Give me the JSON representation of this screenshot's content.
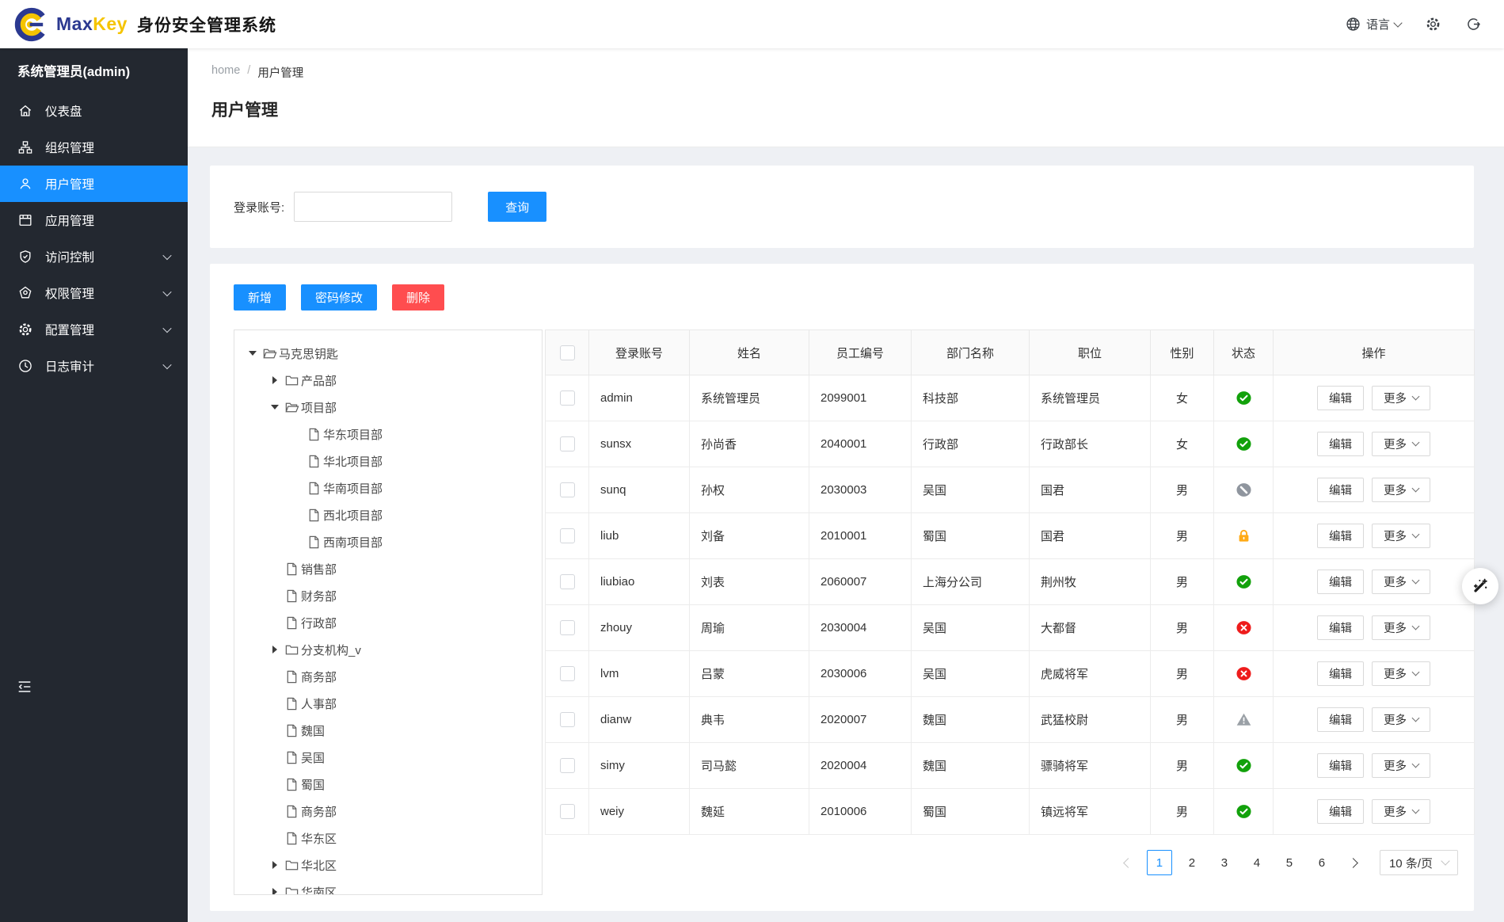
{
  "header": {
    "brand_max": "Max",
    "brand_key": "Key",
    "app_title": "身份安全管理系统",
    "language_label": "语言"
  },
  "sidebar": {
    "user_title": "系统管理员(admin)",
    "items": [
      {
        "key": "dashboard",
        "label": "仪表盘",
        "active": false,
        "expandable": false
      },
      {
        "key": "org",
        "label": "组织管理",
        "active": false,
        "expandable": false
      },
      {
        "key": "user",
        "label": "用户管理",
        "active": true,
        "expandable": false
      },
      {
        "key": "app",
        "label": "应用管理",
        "active": false,
        "expandable": false
      },
      {
        "key": "access",
        "label": "访问控制",
        "active": false,
        "expandable": true
      },
      {
        "key": "permission",
        "label": "权限管理",
        "active": false,
        "expandable": true
      },
      {
        "key": "config",
        "label": "配置管理",
        "active": false,
        "expandable": true
      },
      {
        "key": "audit",
        "label": "日志审计",
        "active": false,
        "expandable": true
      }
    ]
  },
  "breadcrumb": {
    "home": "home",
    "separator": "/",
    "current": "用户管理"
  },
  "page": {
    "title": "用户管理"
  },
  "search": {
    "label": "登录账号:",
    "input_value": "",
    "query_button": "查询"
  },
  "toolbar": {
    "add": "新增",
    "change_password": "密码修改",
    "delete": "删除"
  },
  "tree": {
    "nodes": [
      {
        "label": "马克思钥匙",
        "level": 0,
        "caret": "open",
        "icon": "folder-open"
      },
      {
        "label": "产品部",
        "level": 1,
        "caret": "closed",
        "icon": "folder-closed"
      },
      {
        "label": "项目部",
        "level": 1,
        "caret": "open",
        "icon": "folder-open"
      },
      {
        "label": "华东项目部",
        "level": 2,
        "caret": null,
        "icon": "file"
      },
      {
        "label": "华北项目部",
        "level": 2,
        "caret": null,
        "icon": "file"
      },
      {
        "label": "华南项目部",
        "level": 2,
        "caret": null,
        "icon": "file"
      },
      {
        "label": "西北项目部",
        "level": 2,
        "caret": null,
        "icon": "file"
      },
      {
        "label": "西南项目部",
        "level": 2,
        "caret": null,
        "icon": "file"
      },
      {
        "label": "销售部",
        "level": 1,
        "caret": null,
        "icon": "file"
      },
      {
        "label": "财务部",
        "level": 1,
        "caret": null,
        "icon": "file"
      },
      {
        "label": "行政部",
        "level": 1,
        "caret": null,
        "icon": "file"
      },
      {
        "label": "分支机构_v",
        "level": 1,
        "caret": "closed",
        "icon": "folder-closed"
      },
      {
        "label": "商务部",
        "level": 1,
        "caret": null,
        "icon": "file"
      },
      {
        "label": "人事部",
        "level": 1,
        "caret": null,
        "icon": "file"
      },
      {
        "label": "魏国",
        "level": 1,
        "caret": null,
        "icon": "file"
      },
      {
        "label": "吴国",
        "level": 1,
        "caret": null,
        "icon": "file"
      },
      {
        "label": "蜀国",
        "level": 1,
        "caret": null,
        "icon": "file"
      },
      {
        "label": "商务部",
        "level": 1,
        "caret": null,
        "icon": "file"
      },
      {
        "label": "华东区",
        "level": 1,
        "caret": null,
        "icon": "file"
      },
      {
        "label": "华北区",
        "level": 1,
        "caret": "closed",
        "icon": "folder-closed"
      },
      {
        "label": "华南区",
        "level": 1,
        "caret": "closed",
        "icon": "folder-closed"
      }
    ]
  },
  "table": {
    "columns": [
      "登录账号",
      "姓名",
      "员工编号",
      "部门名称",
      "职位",
      "性别",
      "状态",
      "操作"
    ],
    "actions": {
      "edit": "编辑",
      "more": "更多"
    },
    "rows": [
      {
        "login": "admin",
        "name": "系统管理员",
        "employee_no": "2099001",
        "department": "科技部",
        "position": "系统管理员",
        "gender": "女",
        "status": "active"
      },
      {
        "login": "sunsx",
        "name": "孙尚香",
        "employee_no": "2040001",
        "department": "行政部",
        "position": "行政部长",
        "gender": "女",
        "status": "active"
      },
      {
        "login": "sunq",
        "name": "孙权",
        "employee_no": "2030003",
        "department": "吴国",
        "position": "国君",
        "gender": "男",
        "status": "forbidden"
      },
      {
        "login": "liub",
        "name": "刘备",
        "employee_no": "2010001",
        "department": "蜀国",
        "position": "国君",
        "gender": "男",
        "status": "locked"
      },
      {
        "login": "liubiao",
        "name": "刘表",
        "employee_no": "2060007",
        "department": "上海分公司",
        "position": "荆州牧",
        "gender": "男",
        "status": "active"
      },
      {
        "login": "zhouy",
        "name": "周瑜",
        "employee_no": "2030004",
        "department": "吴国",
        "position": "大都督",
        "gender": "男",
        "status": "inactive"
      },
      {
        "login": "lvm",
        "name": "吕蒙",
        "employee_no": "2030006",
        "department": "吴国",
        "position": "虎威将军",
        "gender": "男",
        "status": "inactive"
      },
      {
        "login": "dianw",
        "name": "典韦",
        "employee_no": "2020007",
        "department": "魏国",
        "position": "武猛校尉",
        "gender": "男",
        "status": "warning"
      },
      {
        "login": "simy",
        "name": "司马懿",
        "employee_no": "2020004",
        "department": "魏国",
        "position": "骠骑将军",
        "gender": "男",
        "status": "active"
      },
      {
        "login": "weiy",
        "name": "魏延",
        "employee_no": "2010006",
        "department": "蜀国",
        "position": "镇远将军",
        "gender": "男",
        "status": "active"
      }
    ],
    "status_colors": {
      "active": "#12a10b",
      "forbidden": "#8f959e",
      "locked": "#ffaa16",
      "inactive": "#ee1c1c",
      "warning": "#9aa0a6"
    },
    "accent_color": "#1890ff",
    "danger_color": "#ff4d4f"
  },
  "pagination": {
    "prev_disabled": true,
    "pages": [
      "1",
      "2",
      "3",
      "4",
      "5",
      "6"
    ],
    "current": "1",
    "page_size": "10 条/页"
  }
}
